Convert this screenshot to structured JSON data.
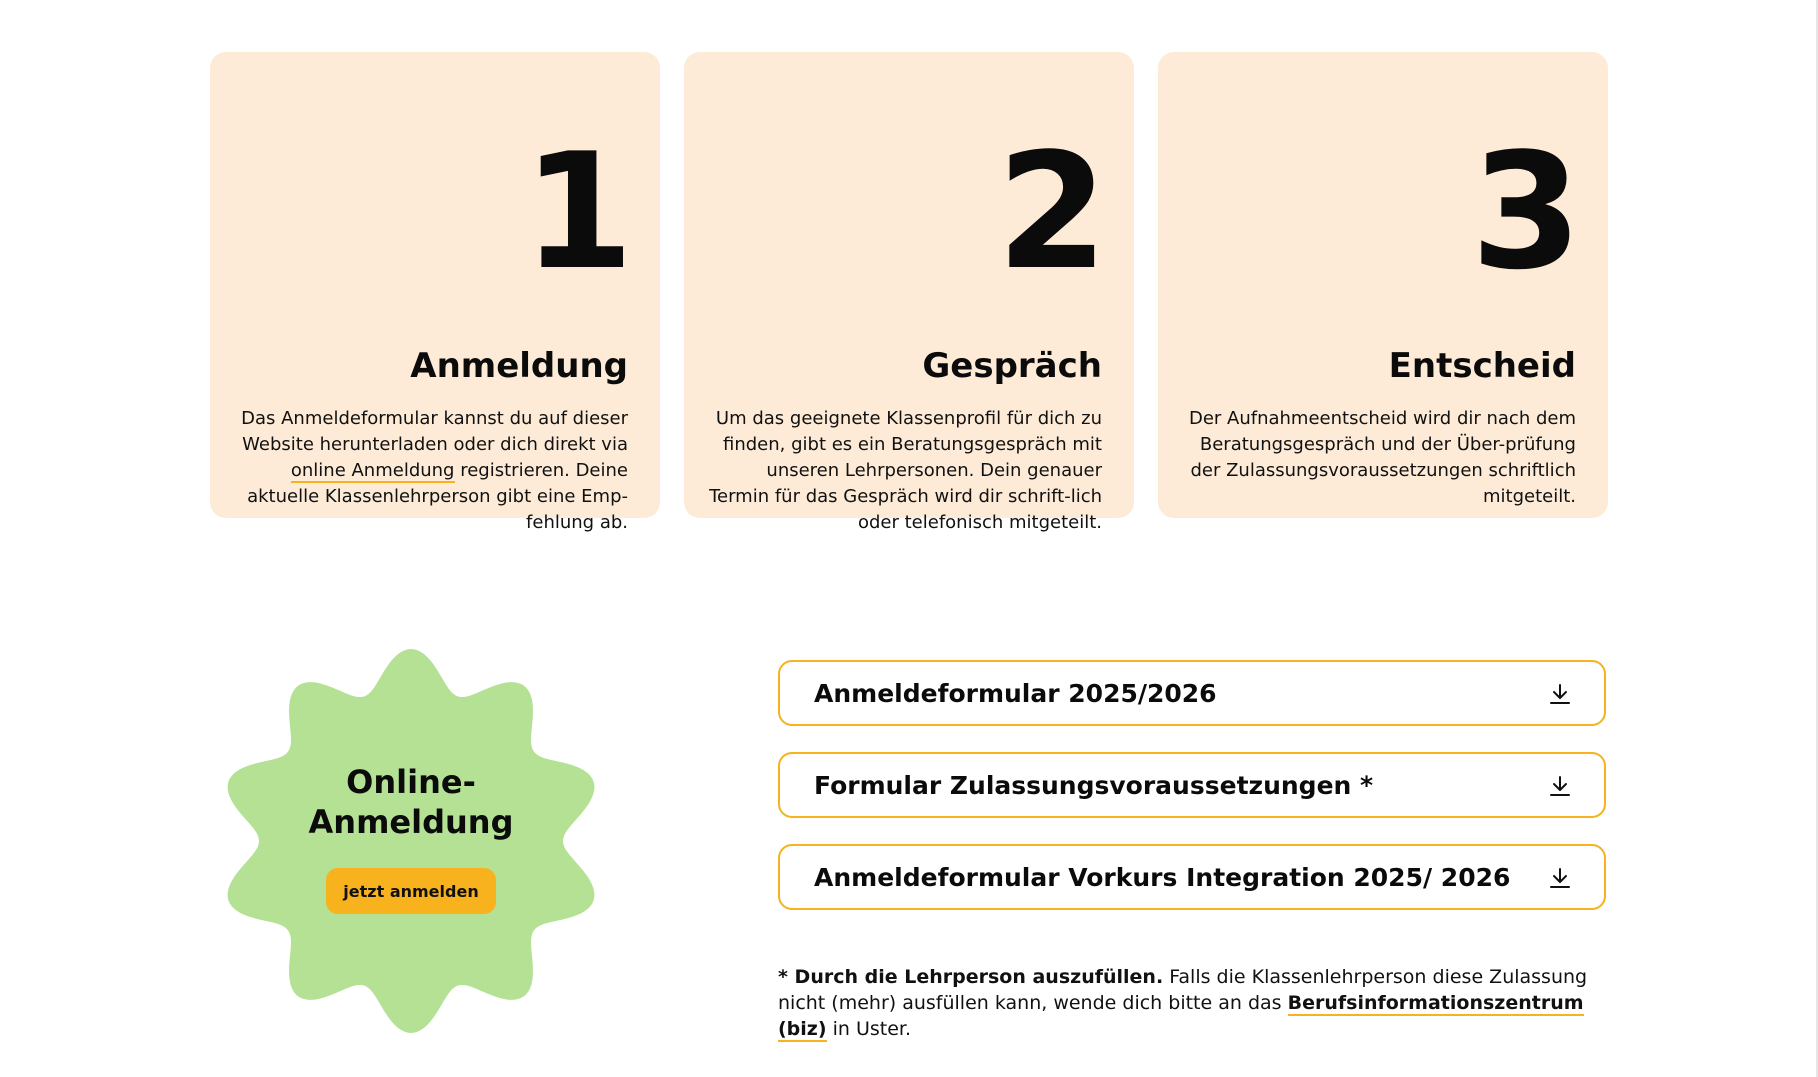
{
  "steps": [
    {
      "number": "1",
      "title": "Anmeldung",
      "text_before": "Das Anmeldeformular kannst du auf dieser Website herunterladen oder dich direkt via ",
      "link": "online Anmeldung",
      "text_after": " registrieren. Deine aktuelle Klassenlehrperson gibt eine Emp-fehlung ab."
    },
    {
      "number": "2",
      "title": "Gespräch",
      "text": "Um das geeignete Klassenprofil für dich zu finden, gibt es ein Beratungsgespräch mit unseren Lehrpersonen. Dein genauer Termin für das Gespräch wird dir schrift-lich oder telefonisch mitgeteilt."
    },
    {
      "number": "3",
      "title": "Entscheid",
      "text": "Der Aufnahmeentscheid wird dir nach dem Beratungsgespräch und der Über-prüfung der Zulassungsvoraussetzungen schriftlich mitgeteilt."
    }
  ],
  "badge": {
    "title_line1": "Online-",
    "title_line2": "Anmeldung",
    "button_label": "jetzt anmelden"
  },
  "downloads": [
    {
      "label": "Anmeldeformular 2025/2026",
      "icon": "download-icon"
    },
    {
      "label": "Formular Zulassungsvoraussetzungen *",
      "icon": "download-icon"
    },
    {
      "label": "Anmeldeformular Vorkurs Integration 2025/ 2026",
      "icon": "download-icon"
    }
  ],
  "note": {
    "strong": "* Durch die Lehrperson auszufüllen.",
    "text_before": " Falls die Klassenlehrperson diese Zulassung nicht (mehr) ausfüllen kann, wende dich bitte an das ",
    "link": "Berufsinformationszentrum (biz)",
    "text_after": " in Uster."
  },
  "colors": {
    "card_background": "#fdebd7",
    "badge_green": "#b4e194",
    "accent_yellow": "#f6b21f"
  }
}
